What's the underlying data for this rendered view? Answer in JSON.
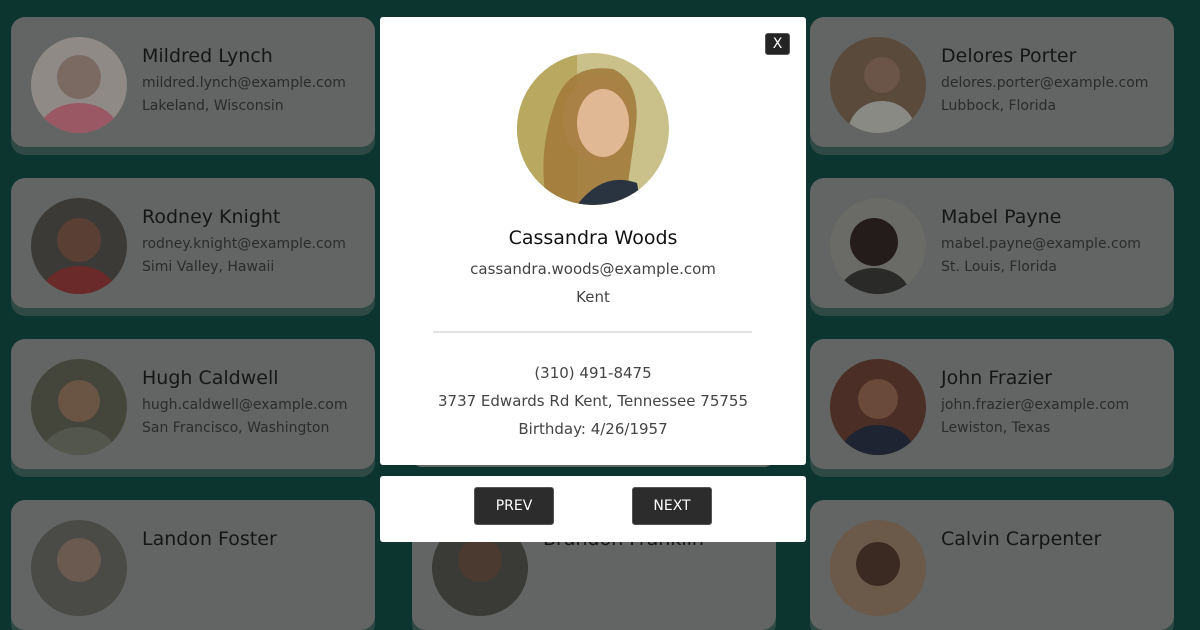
{
  "cards": [
    {
      "name": "Mildred Lynch",
      "email": "mildred.lynch@example.com",
      "location": "Lakeland, Wisconsin",
      "avatar_color": "#b36d7a"
    },
    {
      "name": "Delores Porter",
      "email": "delores.porter@example.com",
      "location": "Lubbock, Florida",
      "avatar_color": "#5c4a3a"
    },
    {
      "name": "Rodney Knight",
      "email": "rodney.knight@example.com",
      "location": "Simi Valley, Hawaii",
      "avatar_color": "#3a3430"
    },
    {
      "name": "Mabel Payne",
      "email": "mabel.payne@example.com",
      "location": "St. Louis, Florida",
      "avatar_color": "#2c2422"
    },
    {
      "name": "Hugh Caldwell",
      "email": "hugh.caldwell@example.com",
      "location": "San Francisco, Washington",
      "avatar_color": "#4a4a3e"
    },
    {
      "name": "John Frazier",
      "email": "john.frazier@example.com",
      "location": "Lewiston, Texas",
      "avatar_color": "#4b2e25"
    },
    {
      "name": "Landon Foster",
      "email": "",
      "location": "",
      "avatar_color": "#4a4a46"
    },
    {
      "name": "Brandon Franklin",
      "email": "",
      "location": "",
      "avatar_color": "#3a3a36"
    },
    {
      "name": "Calvin Carpenter",
      "email": "",
      "location": "",
      "avatar_color": "#6b5a4a"
    }
  ],
  "modal": {
    "close_label": "X",
    "name": "Cassandra Woods",
    "email": "cassandra.woods@example.com",
    "city": "Kent",
    "phone": "(310) 491-8475",
    "address": "3737 Edwards Rd Kent, Tennessee 75755",
    "birthday": "Birthday: 4/26/1957",
    "avatar_color": "#c9a56a"
  },
  "navigation": {
    "prev_label": "PREV",
    "next_label": "NEXT"
  },
  "colors": {
    "page_background": "#0c3530",
    "card_background": "#626563",
    "button_background": "#2c2c2c"
  }
}
